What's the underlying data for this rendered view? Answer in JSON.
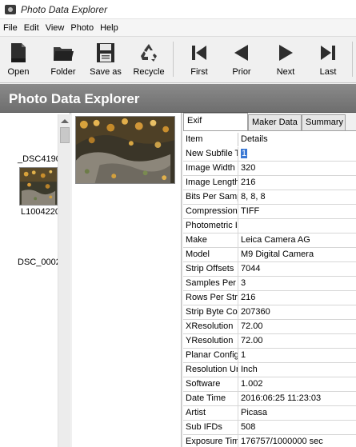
{
  "window": {
    "title": "Photo Data Explorer",
    "app_icon": "camera-icon"
  },
  "menu": [
    "File",
    "Edit",
    "View",
    "Photo",
    "Help"
  ],
  "toolbar": {
    "buttons": [
      {
        "label": "Open",
        "icon": "open-document-icon"
      },
      {
        "label": "Folder",
        "icon": "folder-icon"
      },
      {
        "label": "Save as",
        "icon": "floppy-disk-icon"
      },
      {
        "label": "Recycle",
        "icon": "recycle-icon"
      },
      {
        "label": "First",
        "icon": "skip-first-icon"
      },
      {
        "label": "Prior",
        "icon": "arrow-left-icon"
      },
      {
        "label": "Next",
        "icon": "arrow-right-icon"
      },
      {
        "label": "Last",
        "icon": "skip-last-icon"
      }
    ]
  },
  "header": {
    "title": "Photo Data Explorer"
  },
  "thumbnails": [
    {
      "label": "_DSC4190"
    },
    {
      "label": "L1004220"
    },
    {
      "label": "DSC_0002"
    }
  ],
  "tabs": [
    "Exif Properties",
    "Maker Data",
    "Summary"
  ],
  "grid": {
    "columns": [
      "Item",
      "Details"
    ],
    "rows": [
      {
        "item": "New Subfile T",
        "details": "1"
      },
      {
        "item": "Image Width",
        "details": "320"
      },
      {
        "item": "Image Length",
        "details": "216"
      },
      {
        "item": "Bits Per Samp",
        "details": "8, 8, 8"
      },
      {
        "item": "Compression",
        "details": "TIFF"
      },
      {
        "item": "Photometric I",
        "details": ""
      },
      {
        "item": "Make",
        "details": "Leica Camera AG"
      },
      {
        "item": "Model",
        "details": "M9 Digital Camera"
      },
      {
        "item": "Strip Offsets",
        "details": "7044"
      },
      {
        "item": "Samples Per P",
        "details": "3"
      },
      {
        "item": "Rows Per Strip",
        "details": "216"
      },
      {
        "item": "Strip Byte Cou",
        "details": "207360"
      },
      {
        "item": "XResolution",
        "details": "72.00"
      },
      {
        "item": "YResolution",
        "details": "72.00"
      },
      {
        "item": "Planar Configu",
        "details": "1"
      },
      {
        "item": "Resolution Un",
        "details": "Inch"
      },
      {
        "item": "Software",
        "details": "1.002"
      },
      {
        "item": "Date Time",
        "details": "2016:06:25 11:23:03"
      },
      {
        "item": "Artist",
        "details": "Picasa"
      },
      {
        "item": "Sub IFDs",
        "details": "508"
      },
      {
        "item": "Exposure Time",
        "details": "176757/1000000 sec"
      }
    ]
  },
  "colors": {
    "header_band": "#7a7a7a",
    "selection": "#3a78d4"
  }
}
